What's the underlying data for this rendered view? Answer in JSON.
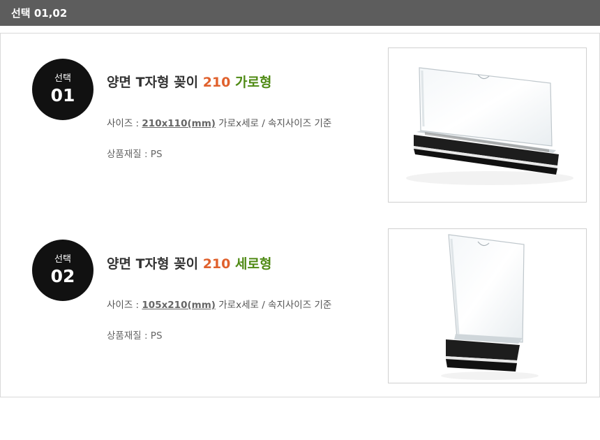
{
  "header": {
    "title": "선택 01,02"
  },
  "options": [
    {
      "badge_label": "선택",
      "badge_number": "01",
      "title_prefix": "양면 T자형 꽂이",
      "title_size": "210",
      "title_orientation": "가로형",
      "size_label": "사이즈 :",
      "size_value": "210x110(mm)",
      "size_note": "가로x세로 / 속지사이즈 기준",
      "material": "상품재질 : PS",
      "image_icon": "landscape-t-stand-icon"
    },
    {
      "badge_label": "선택",
      "badge_number": "02",
      "title_prefix": "양면 T자형 꽂이",
      "title_size": "210",
      "title_orientation": "세로형",
      "size_label": "사이즈 :",
      "size_value": "105x210(mm)",
      "size_note": "가로x세로 / 속지사이즈 기준",
      "material": "상품재질 : PS",
      "image_icon": "portrait-t-stand-icon"
    }
  ],
  "colors": {
    "header_bg": "#5d5d5d",
    "accent_number": "#e0612d",
    "accent_orientation": "#4f8a14",
    "badge_bg": "#111111"
  }
}
